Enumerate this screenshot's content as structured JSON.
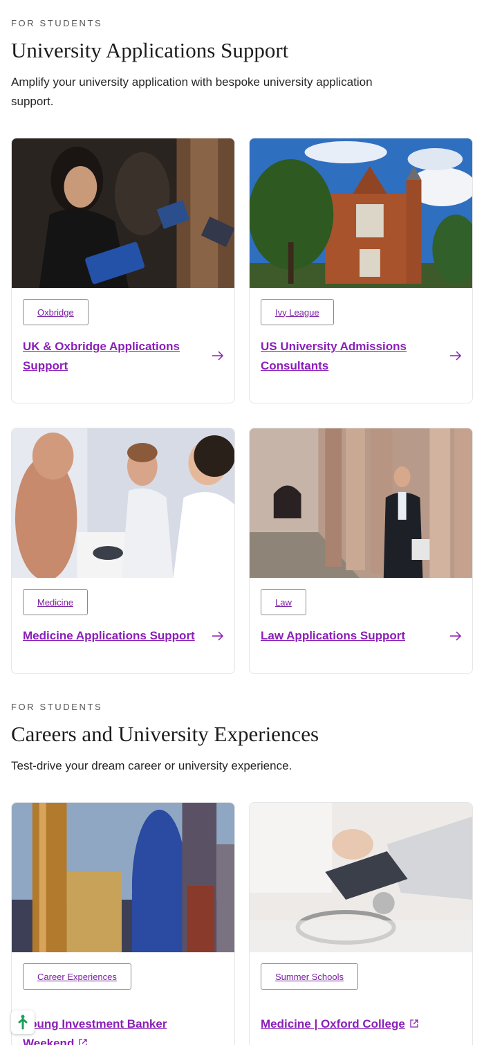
{
  "section1": {
    "eyebrow": "FOR STUDENTS",
    "title": "University Applications Support",
    "description": "Amplify your university application with bespoke university application support."
  },
  "section1_cards": [
    {
      "tag": "Oxbridge",
      "title": "UK & Oxbridge Applications Support",
      "image": "students reading prospectus"
    },
    {
      "tag": "Ivy League",
      "title": "US University Admissions Consultants",
      "image": "red brick university hall"
    },
    {
      "tag": "Medicine",
      "title": "Medicine Applications Support",
      "image": "medical students with anatomy model"
    },
    {
      "tag": "Law",
      "title": "Law Applications Support",
      "image": "man in suit by stone colonnade"
    }
  ],
  "section2": {
    "eyebrow": "FOR STUDENTS",
    "title": "Careers and University Experiences",
    "description": "Test-drive your dream career or university experience."
  },
  "section2_cards": [
    {
      "tag": "Career Experiences",
      "title": "Young Investment Banker Weekend",
      "image": "London skyline skyscrapers"
    },
    {
      "tag": "Summer Schools",
      "title": "Medicine | Oxford College",
      "image": "stethoscope and laptop"
    }
  ],
  "icons": {
    "arrow": "arrow-right-icon",
    "external": "external-link-icon",
    "fab": "accessibility-icon"
  },
  "colors": {
    "accent": "#8a1fb8",
    "tag_text": "#7a1fa2",
    "fab_icon": "#1aa05a"
  }
}
